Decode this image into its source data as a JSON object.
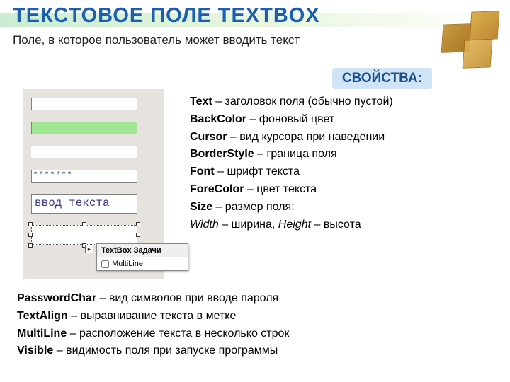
{
  "title": "ТЕКСТОВОЕ ПОЛЕ  TEXTBOX",
  "subtitle": "Поле, в которое пользователь может вводить текст",
  "props_badge": "СВОЙСТВА:",
  "sample": {
    "password_value": "*******",
    "input_value": "ввод текста",
    "tag_title": "TextBox Задачи",
    "tag_option": "MultiLine"
  },
  "properties_right": [
    {
      "name": "Text",
      "desc": " – заголовок поля (обычно пустой)"
    },
    {
      "name": "BackColor",
      "desc": " – фоновый цвет"
    },
    {
      "name": "Cursor",
      "desc": " – вид курсора при наведении"
    },
    {
      "name": "BorderStyle",
      "desc": " – граница поля"
    },
    {
      "name": "Font",
      "desc": " – шрифт текста"
    },
    {
      "name": "ForeColor",
      "desc": " – цвет текста"
    },
    {
      "name": "Size",
      "desc": " – размер поля:"
    }
  ],
  "size_sub": {
    "width_name": "Width",
    "width_desc": " – ширина, ",
    "height_name": "Height",
    "height_desc": " – высота"
  },
  "properties_bottom": [
    {
      "name": "PasswordChar",
      "desc": " – вид символов при вводе пароля"
    },
    {
      "name": "TextAlign",
      "desc": " – выравнивание текста в метке"
    },
    {
      "name": "MultiLine",
      "desc": " – расположение текста в несколько строк"
    },
    {
      "name": "Visible",
      "desc": " – видимость поля при запуске программы"
    }
  ]
}
